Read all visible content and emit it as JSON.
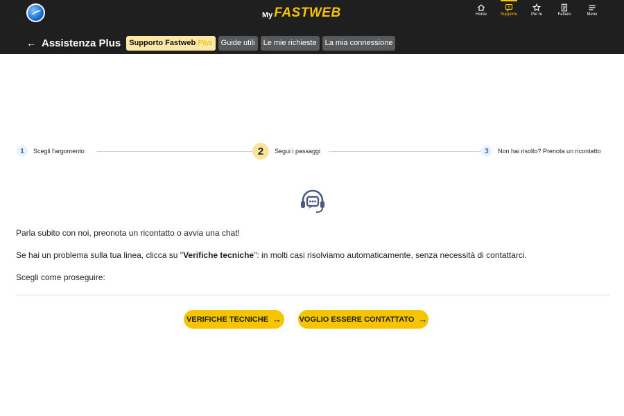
{
  "header": {
    "brand_prefix": "My",
    "brand_name": "FASTWEB",
    "nav": [
      {
        "label": "Home",
        "icon": "home-icon"
      },
      {
        "label": "Supporto",
        "icon": "support-icon",
        "active": true
      },
      {
        "label": "Per te",
        "icon": "star-icon"
      },
      {
        "label": "Fatture",
        "icon": "invoice-icon"
      },
      {
        "label": "Menu",
        "icon": "menu-icon"
      }
    ]
  },
  "subnav": {
    "title": "Assistenza Plus",
    "tabs": [
      {
        "label": "Supporto Fastweb",
        "suffix": "Plus",
        "active": true
      },
      {
        "label": "Guide utili"
      },
      {
        "label": "Le mie richieste"
      },
      {
        "label": "La mia connessione"
      }
    ]
  },
  "stepper": {
    "steps": [
      {
        "number": "1",
        "label": "Scegli l'argomento"
      },
      {
        "number": "2",
        "label": "Segui i passaggi",
        "current": true
      },
      {
        "number": "3",
        "label": "Non hai risolto? Prenota un ricontatto"
      }
    ]
  },
  "content": {
    "intro": "Parla subito con noi, preonota un ricontatto o avvia una chat!",
    "tech_prefix": "Se hai un problema sulla tua linea, clicca su \"",
    "tech_bold": "Verifiche tecniche",
    "tech_suffix": "\": in molti casi risolviamo automaticamente, senza necessità di contattarci.",
    "choose": "Scegli come proseguire:"
  },
  "actions": {
    "technical_checks": "VERIFICHE TECNICHE",
    "contact_me": "VOGLIO ESSERE CONTATTATO",
    "arrow": "→"
  },
  "colors": {
    "header_bg": "#1f1f1f",
    "accent_yellow": "#f6c400",
    "chip_bg": "#58595b",
    "step_blue": "#1a73c8",
    "icon_slate": "#4d5a80"
  }
}
